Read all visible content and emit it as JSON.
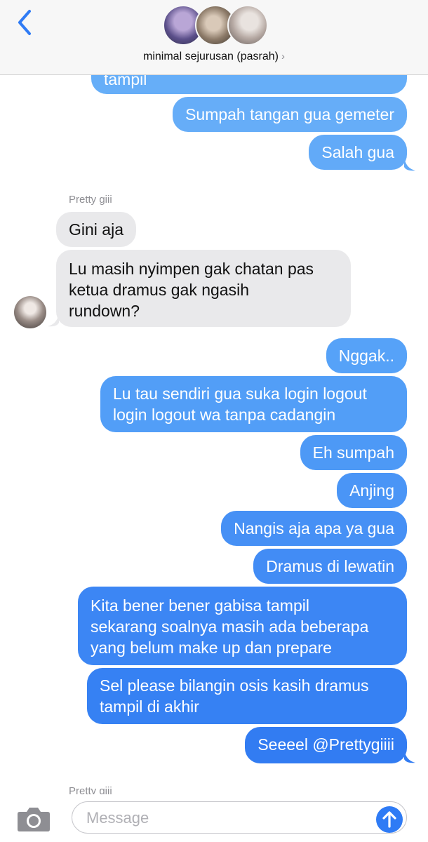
{
  "header": {
    "title": "minimal sejurusan (pasrah)",
    "title_chevron": "›",
    "back_icon": "chevron-left-icon",
    "avatars": [
      "group-member-avatar-1",
      "group-member-avatar-2",
      "group-member-avatar-3"
    ]
  },
  "messages": [
    {
      "kind": "out",
      "text": "tampil",
      "color": "#66aef8"
    },
    {
      "kind": "out",
      "text": "Sumpah tangan gua gemeter",
      "color": "#66adf8"
    },
    {
      "kind": "out",
      "text": "Salah gua",
      "color": "#62aaf8"
    },
    {
      "kind": "sender",
      "text": "Pretty giii"
    },
    {
      "kind": "in",
      "text": "Gini aja"
    },
    {
      "kind": "in",
      "text": "Lu masih nyimpen gak chatan pas\nketua dramus gak ngasih\nrundown?"
    },
    {
      "kind": "out",
      "text": "Nggak..",
      "color": "#56a2f8"
    },
    {
      "kind": "out",
      "text": "Lu tau sendiri gua suka login logout\nlogin logout wa tanpa cadangin",
      "color": "#529ef7"
    },
    {
      "kind": "out",
      "text": "Eh sumpah",
      "color": "#4d99f6"
    },
    {
      "kind": "out",
      "text": "Anjing",
      "color": "#4a95f6"
    },
    {
      "kind": "out",
      "text": "Nangis aja apa ya gua",
      "color": "#4690f5"
    },
    {
      "kind": "out",
      "text": "Dramus di lewatin",
      "color": "#428cf5"
    },
    {
      "kind": "out",
      "text": "Kita bener bener gabisa tampil\nsekarang soalnya masih ada beberapa\nyang belum make up dan prepare",
      "color": "#3c86f4"
    },
    {
      "kind": "out",
      "text": "Sel please bilangin osis kasih dramus\ntampil di akhir",
      "color": "#3681f3"
    },
    {
      "kind": "out",
      "text": "Seeeel @Prettygiiii",
      "color": "#327cf2"
    },
    {
      "kind": "sender",
      "text": "Pretty giii"
    }
  ],
  "input": {
    "placeholder": "Message",
    "camera_icon": "camera-icon",
    "send_icon": "send-arrow-up-icon"
  },
  "colors": {
    "incoming_bubble": "#e9e9eb",
    "accent_blue": "#2f7bf5",
    "header_bg": "#f7f7f7"
  }
}
